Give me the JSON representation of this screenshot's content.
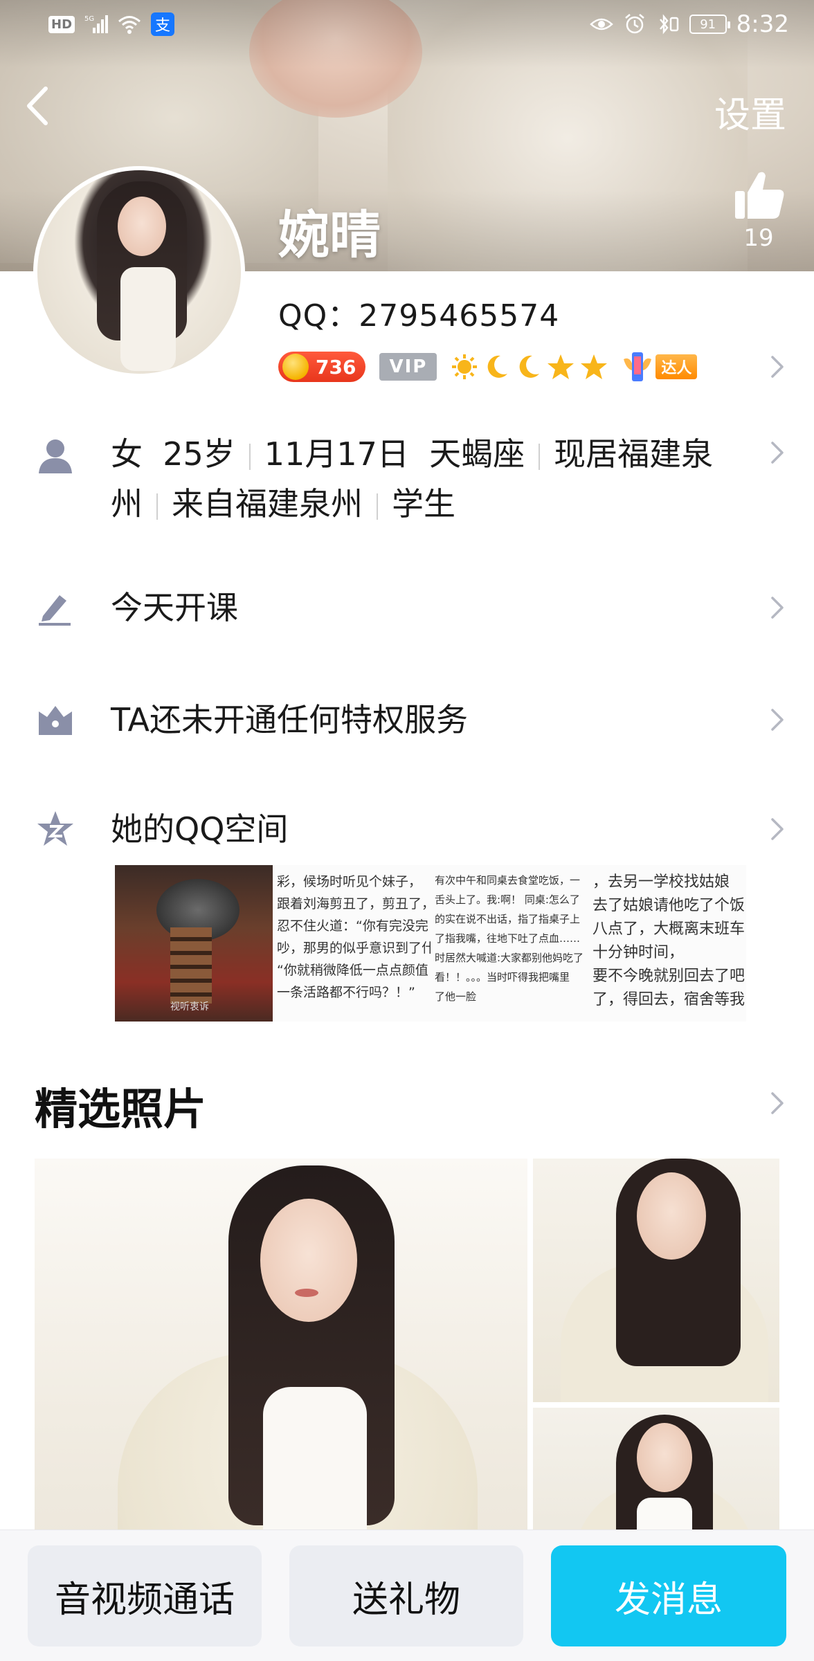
{
  "status_bar": {
    "left_chips": [
      "HD",
      "5G"
    ],
    "battery": "91",
    "time": "8:32"
  },
  "header": {
    "settings_label": "设置",
    "nickname": "婉晴",
    "like_count": "19",
    "qq_label": "QQ：",
    "qq_number": "2795465574"
  },
  "badges": {
    "coin_value": "736",
    "vip_label": "VIP",
    "daren_label": "达人"
  },
  "profile_info": {
    "line1": [
      "女",
      "25岁",
      "11月17日",
      "天蝎座",
      "现居福建泉"
    ],
    "line2": [
      "州",
      "来自福建泉州",
      "学生"
    ]
  },
  "signature": {
    "text": "今天开课"
  },
  "privilege": {
    "text": "TA还未开通任何特权服务"
  },
  "qzone": {
    "label": "她的QQ空间",
    "thumb1_caption": "视听衷诉",
    "thumb2_lines": [
      "彩，候场时听见个妹子，",
      "跟着刘海剪丑了，剪丑了，",
      "忍不住火道：“你有完没完",
      "吵，那男的似乎意识到了什",
      "“你就稍微降低一点点颜值",
      "一条活路都不行吗？！”"
    ],
    "thumb3_lines": [
      "有次中午和同桌去食堂吃饭，一",
      "舌头上了。我:啊！ 同桌:怎么了",
      "的实在说不出话，指了指桌子上",
      "了指我嘴，往地下吐了点血……",
      "时居然大喊道:大家都别他妈吃了",
      "看！！。。。当时吓得我把嘴里",
      "了他一脸"
    ],
    "thumb4_lines": [
      "，去另一学校找姑娘",
      "去了姑娘请他吃了个饭",
      "八点了，大概离末班车",
      "十分钟时间，",
      "要不今晚就别回去了吧",
      "了，得回去，宿舍等我"
    ]
  },
  "featured_photos": {
    "title": "精选照片"
  },
  "actions": {
    "call_label": "音视频通话",
    "gift_label": "送礼物",
    "message_label": "发消息"
  },
  "colors": {
    "accent": "#12c7f2",
    "coin_badge": "#e8361c",
    "vip_badge": "#a9adb4",
    "icon_gray": "#8a8fa8"
  }
}
